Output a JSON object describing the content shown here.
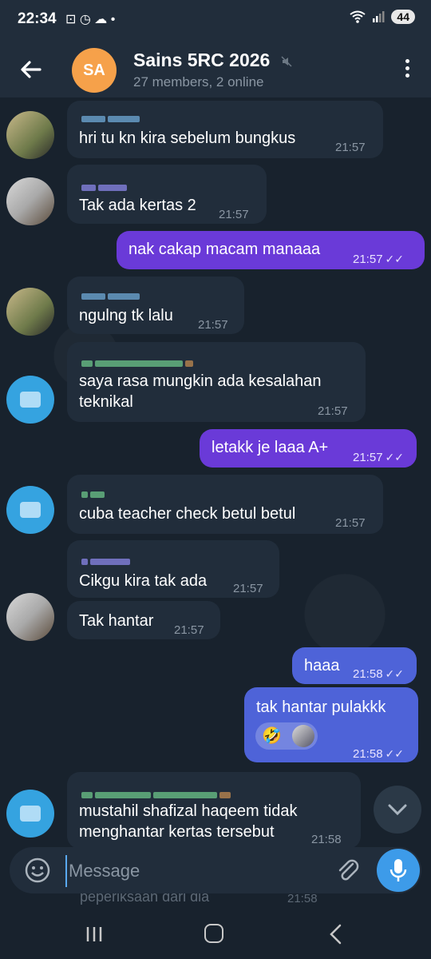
{
  "status": {
    "time": "22:34",
    "icons": "⊡ ◷ ☁ •",
    "battery": "44"
  },
  "header": {
    "avatar_initials": "SA",
    "title": "Sains 5RC 2026",
    "subtitle": "27 members, 2 online"
  },
  "messages": [
    {
      "text": "hri tu kn kira sebelum bungkus",
      "time": "21:57"
    },
    {
      "text": "Tak ada kertas 2",
      "time": "21:57"
    },
    {
      "text": "nak cakap macam manaaa",
      "time": "21:57"
    },
    {
      "text": "ngulng tk lalu",
      "time": "21:57"
    },
    {
      "text": "saya rasa mungkin ada kesalahan",
      "text2": "teknikal",
      "time": "21:57"
    },
    {
      "text": "letakk je laaa A+",
      "time": "21:57"
    },
    {
      "text": "cuba teacher check betul betul",
      "time": "21:57"
    },
    {
      "text": "Cikgu kira tak ada",
      "time": "21:57"
    },
    {
      "text": "Tak hantar",
      "time": "21:57"
    },
    {
      "text": "haaa",
      "time": "21:58"
    },
    {
      "text": "tak hantar pulakkk",
      "emoji": "🤣",
      "time": "21:58"
    },
    {
      "text": "mustahil shafizal haqeem tidak",
      "text2": "menghantar kertas tersebut",
      "time": "21:58"
    }
  ],
  "input": {
    "placeholder": "Message"
  },
  "underlay": {
    "text": "peperiksaan dari dia",
    "time": "21:58"
  },
  "colors": {
    "accent": "#3d9be9",
    "outgoing": "#6a3ad8",
    "incoming": "#212d3b"
  }
}
